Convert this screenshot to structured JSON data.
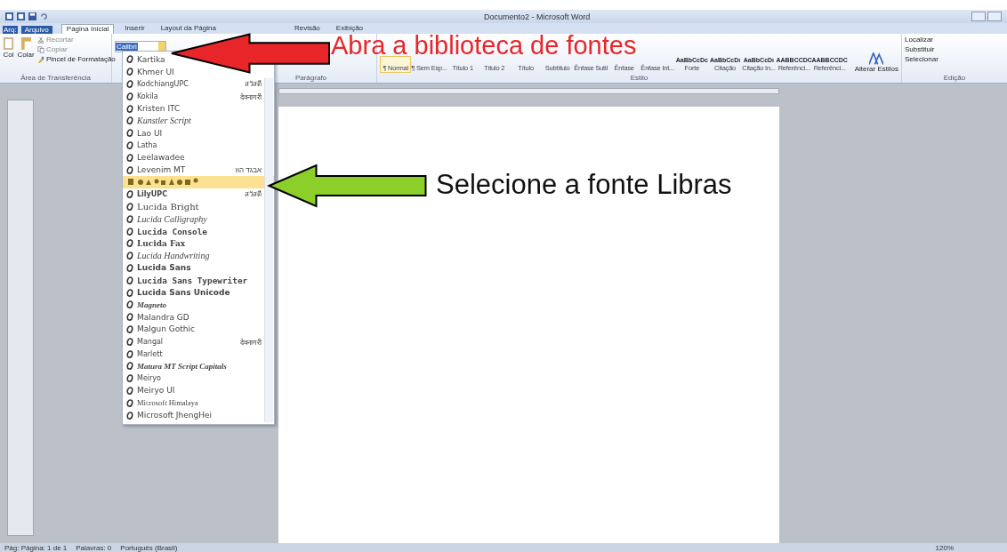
{
  "window": {
    "title": "Documento2 - Microsoft Word"
  },
  "file_tab": {
    "prefix": "Arq:",
    "label": "Arquivo"
  },
  "tabs": [
    {
      "label": "Página Inicial",
      "selected": true
    },
    {
      "label": "Inserir",
      "selected": false
    },
    {
      "label": "Layout da Página",
      "selected": false
    },
    {
      "label": "Revisão",
      "selected": false
    },
    {
      "label": "Exibição",
      "selected": false
    }
  ],
  "clipboard": {
    "cut_label": "Col",
    "paste": "Colar",
    "cut": "Recortar",
    "copy": "Copiar",
    "format_painter": "Pincel de Formatação",
    "group": "Área de Transferência"
  },
  "font_box": {
    "value": "Calibri"
  },
  "paragraph": {
    "group": "Parágrafo"
  },
  "styles": {
    "group": "Estilo",
    "items": [
      {
        "label": "¶ Normal",
        "selected": true
      },
      {
        "label": "¶ Sem Esp...",
        "selected": false
      },
      {
        "label": "Título 1",
        "selected": false
      },
      {
        "label": "Título 2",
        "selected": false
      },
      {
        "label": "Título",
        "selected": false
      },
      {
        "label": "Subtítulo",
        "selected": false
      },
      {
        "label": "Ênfase Sutil",
        "selected": false
      },
      {
        "label": "Ênfase",
        "selected": false
      },
      {
        "label": "Ênfase Int...",
        "selected": false
      },
      {
        "label": "Forte",
        "sample": "AaBbCcDc",
        "selected": false
      },
      {
        "label": "Citação",
        "sample": "AaBbCcDı",
        "selected": false
      },
      {
        "label": "Citação In...",
        "sample": "AaBbCcDı",
        "selected": false
      },
      {
        "label": "Referênci...",
        "sample": "AABBCCDC",
        "selected": false
      },
      {
        "label": "Referênci...",
        "sample": "AABBCCDC",
        "selected": false
      }
    ],
    "change": "Alterar Estilos"
  },
  "editing": {
    "group": "Edição",
    "items": [
      "Localizar",
      "Substituir",
      "Selecionar"
    ]
  },
  "font_list": [
    {
      "name": "Kartika",
      "kind": "plain",
      "selected": false
    },
    {
      "name": "Khmer UI",
      "kind": "plain",
      "selected": false
    },
    {
      "name": "KodchiangUPC",
      "kind": "small",
      "sample": "สวัสดี",
      "selected": false
    },
    {
      "name": "Kokila",
      "kind": "small",
      "sample": "देवनागरी",
      "selected": false
    },
    {
      "name": "Kristen ITC",
      "kind": "plain",
      "selected": false
    },
    {
      "name": "Kunstler Script",
      "kind": "script",
      "selected": false
    },
    {
      "name": "Lao UI",
      "kind": "plain",
      "selected": false
    },
    {
      "name": "Latha",
      "kind": "small",
      "selected": false
    },
    {
      "name": "Leelawadee",
      "kind": "plain",
      "selected": false
    },
    {
      "name": "Levenim MT",
      "kind": "plain",
      "sample": "אבגד הוז",
      "selected": false
    },
    {
      "kind": "symbols",
      "selected": true
    },
    {
      "name": "LilyUPC",
      "kind": "bold-small",
      "sample": "สวัสดี",
      "selected": false
    },
    {
      "name": "Lucida Bright",
      "kind": "serif",
      "selected": false
    },
    {
      "name": "Lucida Calligraphy",
      "kind": "script",
      "selected": false
    },
    {
      "name": "Lucida Console",
      "kind": "mono",
      "selected": false
    },
    {
      "name": "Lucida Fax",
      "kind": "bold-serif",
      "selected": false
    },
    {
      "name": "Lucida Handwriting",
      "kind": "script",
      "selected": false
    },
    {
      "name": "Lucida Sans",
      "kind": "bold",
      "selected": false
    },
    {
      "name": "Lucida Sans Typewriter",
      "kind": "mono",
      "selected": false
    },
    {
      "name": "Lucida Sans Unicode",
      "kind": "bold",
      "selected": false
    },
    {
      "name": "Magneto",
      "kind": "bold-script",
      "selected": false
    },
    {
      "name": "Malandra GD",
      "kind": "plain",
      "selected": false
    },
    {
      "name": "Malgun Gothic",
      "kind": "plain",
      "selected": false
    },
    {
      "name": "Mangal",
      "kind": "small",
      "sample": "देवनागरी",
      "selected": false
    },
    {
      "name": "Marlett",
      "kind": "small",
      "selected": false
    },
    {
      "name": "Matura MT Script Capitals",
      "kind": "bold-script",
      "selected": false
    },
    {
      "name": "Meiryo",
      "kind": "small",
      "selected": false
    },
    {
      "name": "Meiryo UI",
      "kind": "plain",
      "selected": false
    },
    {
      "name": "Microsoft Himalaya",
      "kind": "small-serif",
      "selected": false
    },
    {
      "name": "Microsoft JhengHei",
      "kind": "plain",
      "selected": false
    }
  ],
  "status_bar": [
    "Pág: Página: 1 de 1",
    "Palavras: 0",
    "Português (Brasil)",
    "120%"
  ],
  "annotations": [
    {
      "text": "Abra a biblioteca de fontes",
      "color": "#e8262a"
    },
    {
      "text": "Selecione a fonte Libras",
      "color": "#8ccf2a"
    }
  ]
}
